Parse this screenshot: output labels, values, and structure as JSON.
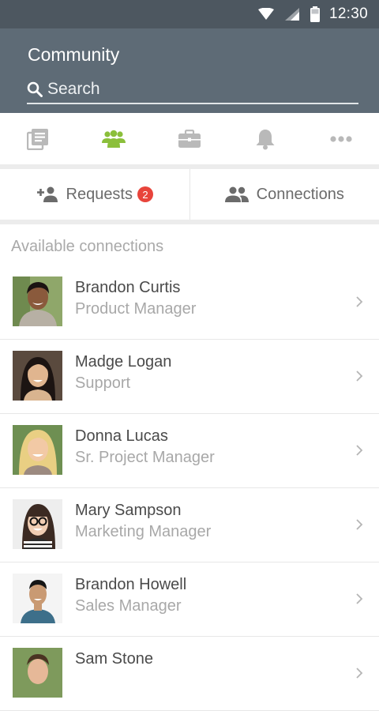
{
  "status_bar": {
    "time": "12:30"
  },
  "header": {
    "title": "Community",
    "search_placeholder": "Search"
  },
  "tabs": [
    {
      "icon": "news-icon",
      "active": false
    },
    {
      "icon": "community-icon",
      "active": true
    },
    {
      "icon": "briefcase-icon",
      "active": false
    },
    {
      "icon": "bell-icon",
      "active": false
    },
    {
      "icon": "more-icon",
      "active": false
    }
  ],
  "segments": {
    "requests_label": "Requests",
    "requests_count": "2",
    "connections_label": "Connections"
  },
  "section_label": "Available connections",
  "connections": [
    {
      "name": "Brandon Curtis",
      "role": "Product Manager"
    },
    {
      "name": "Madge Logan",
      "role": "Support"
    },
    {
      "name": "Donna Lucas",
      "role": "Sr. Project Manager"
    },
    {
      "name": "Mary Sampson",
      "role": "Marketing Manager"
    },
    {
      "name": "Brandon Howell",
      "role": "Sales Manager"
    },
    {
      "name": "Sam Stone",
      "role": ""
    }
  ],
  "colors": {
    "header_bg": "#5e6b76",
    "status_bg": "#4d5760",
    "accent_green": "#8bbf3b",
    "icon_gray": "#b9b9b9",
    "badge_red": "#e8443b"
  }
}
